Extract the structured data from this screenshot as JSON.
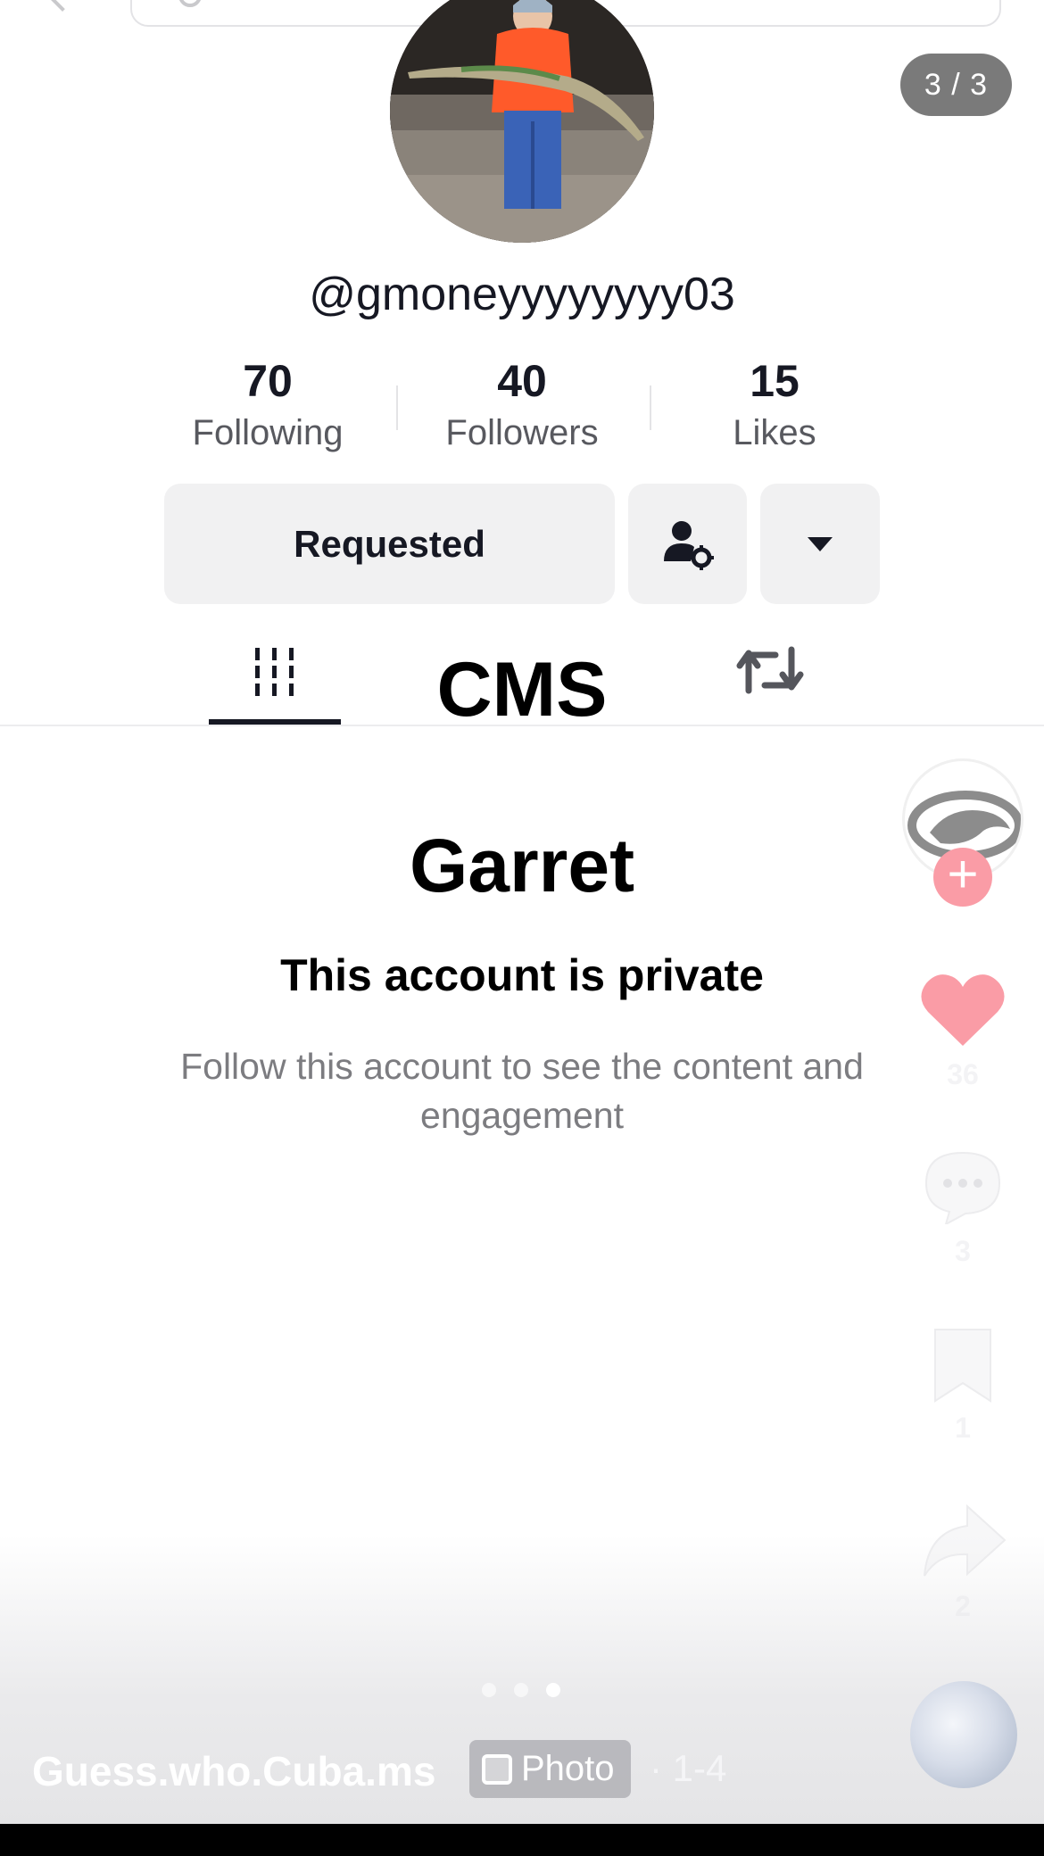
{
  "header": {
    "page_counter": "3 / 3"
  },
  "profile": {
    "username": "@gmoneyyyyyyyy03",
    "stats": [
      {
        "value": "70",
        "label": "Following"
      },
      {
        "value": "40",
        "label": "Followers"
      },
      {
        "value": "15",
        "label": "Likes"
      }
    ],
    "requested_label": "Requested"
  },
  "tabs": {
    "text_overlay": "CMS"
  },
  "private_notice": {
    "name": "Garret",
    "title": "This account is private",
    "description": "Follow this account to see the content and engagement"
  },
  "rail": {
    "likes": "36",
    "comments": "3",
    "saves": "1",
    "shares": "2"
  },
  "post": {
    "caption": "Guess.who.Cuba.ms",
    "badge_label": "Photo",
    "range": "· 1-4",
    "current_slide": 3,
    "total_slides": 3
  },
  "colors": {
    "like_heart": "#fa9ca6",
    "counter_bg": "#7a7a7a",
    "button_bg": "#f1f1f2"
  },
  "icons": [
    "back-icon",
    "search-icon",
    "person-settings-icon",
    "caret-down-icon",
    "grid-icon",
    "repost-icon",
    "plus-icon",
    "heart-icon",
    "comment-icon",
    "bookmark-icon",
    "share-icon",
    "photo-icon"
  ]
}
